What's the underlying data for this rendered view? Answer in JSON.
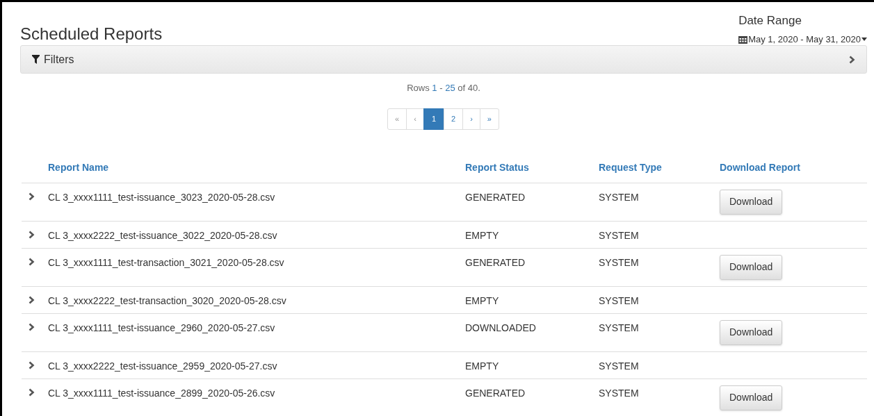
{
  "title": "Scheduled Reports",
  "date_range": {
    "label": "Date Range",
    "value": "May 1, 2020 - May 31, 2020"
  },
  "filters": {
    "label": "Filters",
    "expanded": false
  },
  "rows_summary": {
    "prefix": "Rows",
    "from": "1",
    "separator": "-",
    "to": "25",
    "suffix": "of 40."
  },
  "pagination": [
    {
      "label": "«",
      "selected": false,
      "disabled": true
    },
    {
      "label": "‹",
      "selected": false,
      "disabled": true
    },
    {
      "label": "1",
      "selected": true,
      "disabled": false
    },
    {
      "label": "2",
      "selected": false,
      "disabled": false
    },
    {
      "label": "›",
      "selected": false,
      "disabled": false
    },
    {
      "label": "»",
      "selected": false,
      "disabled": false
    }
  ],
  "table": {
    "columns": [
      "Report Name",
      "Report Status",
      "Request Type",
      "Download Report"
    ],
    "rows": [
      {
        "name": "CL 3_xxxx1111_test-issuance_3023_2020-05-28.csv",
        "status": "GENERATED",
        "type": "SYSTEM",
        "action": "Download"
      },
      {
        "name": "CL 3_xxxx2222_test-issuance_3022_2020-05-28.csv",
        "status": "EMPTY",
        "type": "SYSTEM"
      },
      {
        "name": "CL 3_xxxx1111_test-transaction_3021_2020-05-28.csv",
        "status": "GENERATED",
        "type": "SYSTEM",
        "action": "Download"
      },
      {
        "name": "CL 3_xxxx2222_test-transaction_3020_2020-05-28.csv",
        "status": "EMPTY",
        "type": "SYSTEM"
      },
      {
        "name": "CL 3_xxxx1111_test-issuance_2960_2020-05-27.csv",
        "status": "DOWNLOADED",
        "type": "SYSTEM",
        "action": "Download"
      },
      {
        "name": "CL 3_xxxx2222_test-issuance_2959_2020-05-27.csv",
        "status": "EMPTY",
        "type": "SYSTEM"
      },
      {
        "name": "CL 3_xxxx1111_test-issuance_2899_2020-05-26.csv",
        "status": "GENERATED",
        "type": "SYSTEM",
        "action": "Download"
      }
    ]
  }
}
